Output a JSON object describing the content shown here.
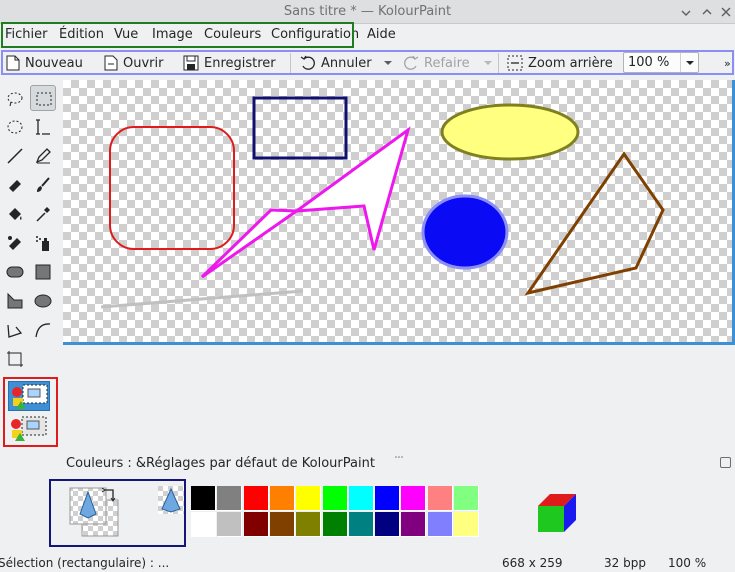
{
  "window": {
    "title": "Sans titre * — KolourPaint"
  },
  "menubar": {
    "items": [
      {
        "label": "Fichier"
      },
      {
        "label": "Édition"
      },
      {
        "label": "Vue"
      },
      {
        "label": "Image"
      },
      {
        "label": "Couleurs"
      },
      {
        "label": "Configuration"
      },
      {
        "label": "Aide"
      }
    ]
  },
  "toolbar": {
    "new_label": "Nouveau",
    "open_label": "Ouvrir",
    "save_label": "Enregistrer",
    "undo_label": "Annuler",
    "redo_label": "Refaire",
    "zoom_out_label": "Zoom arrière",
    "zoom_value": "100 %",
    "overflow_label": "»"
  },
  "colors_panel": {
    "label": "Couleurs : &Réglages par défaut de KolourPaint"
  },
  "palette": {
    "row1": [
      "#000000",
      "#808080",
      "#ff0000",
      "#ff8000",
      "#ffff00",
      "#00ff00",
      "#00ffff",
      "#0000ff",
      "#ff00ff",
      "#ff8080",
      "#80ff80"
    ],
    "row2": [
      "#ffffff",
      "#c0c0c0",
      "#800000",
      "#804000",
      "#808000",
      "#008000",
      "#008080",
      "#000080",
      "#800080",
      "#8080ff",
      "#ffff80"
    ]
  },
  "statusbar": {
    "message": "Sélection (rectangulaire) : ...",
    "dimensions": "668 x 259",
    "depth": "32 bpp",
    "zoom": "100 %"
  },
  "colors": {
    "menu_highlight": "#1e7d1e",
    "toolbar_highlight": "#8a8ef5",
    "tool_options_highlight": "#e01b1b",
    "color_box_highlight": "#16167a",
    "canvas_border": "#3d8fd6"
  }
}
